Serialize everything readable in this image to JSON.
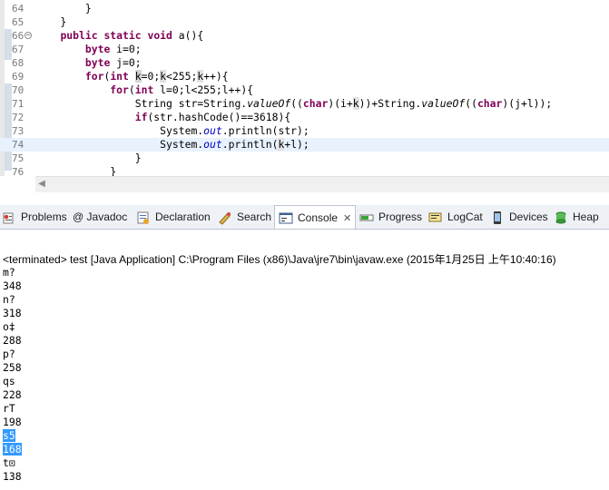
{
  "editor": {
    "lines": [
      {
        "num": "64",
        "html": "        }"
      },
      {
        "num": "65",
        "html": "    }"
      },
      {
        "num": "66",
        "html": "    <span class=\"kw\">public</span> <span class=\"kw\">static</span> <span class=\"kw\">void</span> a(){",
        "fold": true
      },
      {
        "num": "67",
        "html": "        <span class=\"kw\">byte</span> i=0;"
      },
      {
        "num": "68",
        "html": "        <span class=\"kw\">byte</span> j=0;"
      },
      {
        "num": "69",
        "html": "        <span class=\"kw\">for</span>(<span class=\"kw\">int</span> <span class=\"occ\">k</span>=0;<span class=\"occ2\">k</span>&lt;255;<span class=\"occ2\">k</span>++){"
      },
      {
        "num": "70",
        "html": "            <span class=\"kw\">for</span>(<span class=\"kw\">int</span> l=0;l&lt;255;l++){"
      },
      {
        "num": "71",
        "html": "                String str=String.<span class=\"ital\">valueOf</span>((<span class=\"kw\">char</span>)(i+<span class=\"occ2\">k</span>))+String.<span class=\"ital\">valueOf</span>((<span class=\"kw\">char</span>)(j+l));"
      },
      {
        "num": "72",
        "html": "                <span class=\"kw\">if</span>(str.hashCode()==3618){"
      },
      {
        "num": "73",
        "html": "                    System.<span class=\"fld\">out</span>.println(str);"
      },
      {
        "num": "74",
        "html": "                    System.<span class=\"fld\">out</span>.println(<span class=\"occ2\">k</span>+l);",
        "current": true
      },
      {
        "num": "75",
        "html": "                }"
      },
      {
        "num": "76",
        "html": "            }"
      }
    ]
  },
  "views": {
    "tabs": [
      {
        "label": "Problems",
        "icon": "problems-icon"
      },
      {
        "label": "@ Javadoc",
        "icon": "javadoc-icon"
      },
      {
        "label": "Declaration",
        "icon": "declaration-icon"
      },
      {
        "label": "Search",
        "icon": "search-icon"
      },
      {
        "label": "Console",
        "icon": "console-icon",
        "active": true,
        "close": "✕"
      },
      {
        "label": "Progress",
        "icon": "progress-icon"
      },
      {
        "label": "LogCat",
        "icon": "logcat-icon"
      },
      {
        "label": "Devices",
        "icon": "devices-icon"
      },
      {
        "label": "Heap",
        "icon": "heap-icon"
      }
    ]
  },
  "console": {
    "terminated": "<terminated> test [Java Application] C:\\Program Files (x86)\\Java\\jre7\\bin\\javaw.exe (2015年1月25日 上午10:40:16)",
    "output": [
      {
        "text": "m?"
      },
      {
        "text": "348"
      },
      {
        "text": "n?"
      },
      {
        "text": "318"
      },
      {
        "text": "o‡"
      },
      {
        "text": "288"
      },
      {
        "text": "p?"
      },
      {
        "text": "258"
      },
      {
        "text": "qs"
      },
      {
        "text": "228"
      },
      {
        "text": "rT"
      },
      {
        "text": "198"
      },
      {
        "text": "s5",
        "selected": true
      },
      {
        "text": "168",
        "selected": true
      },
      {
        "text": "t⊡"
      },
      {
        "text": "138"
      }
    ]
  },
  "colors": {
    "keyword": "#7f0055",
    "field": "#0000c0",
    "selection": "#3399ff",
    "current_line": "#e8f2fe"
  }
}
